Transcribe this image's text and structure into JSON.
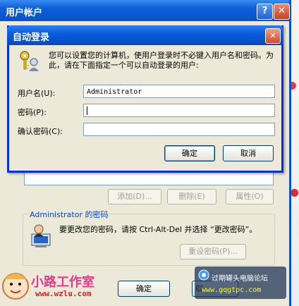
{
  "back_window": {
    "title": "用户帐户",
    "help_button": "?",
    "close_button": "✕",
    "buttons": {
      "add": "添加(D)...",
      "remove": "删除(E)",
      "properties": "属性(O)"
    },
    "password_group": {
      "title": "Administrator 的密码",
      "text": "要更改您的密码，请按 Ctrl-Alt-Del 并选择 “更改密码”。",
      "reset_button": "重设密码(P)..."
    },
    "ok_button": "确定",
    "cancel_button": "取"
  },
  "dialog": {
    "title": "自动登录",
    "close_button": "✕",
    "description": "您可以设置您的计算机，使用户登录时不必键入用户名和密码。为此，请在下面指定一个可以自动登录的用户:",
    "username_label": "用户名(U):",
    "username_value": "Administrator",
    "password_label": "密码(P):",
    "confirm_label": "确认密码(C):",
    "ok_button": "确定",
    "cancel_button": "取消"
  },
  "watermarks": {
    "left_brand": "小路工作室",
    "left_url": "www.wzlu.com",
    "right_brand": "过期罐头电脑论坛",
    "right_url": "www.gqgtpc.com"
  },
  "colors": {
    "titlebar": "#0a5bd8",
    "window_bg": "#ece9d8",
    "close_button": "#d44a27"
  },
  "icons": [
    "key-user-icon",
    "user-computer-icon",
    "help-icon",
    "close-icon"
  ]
}
